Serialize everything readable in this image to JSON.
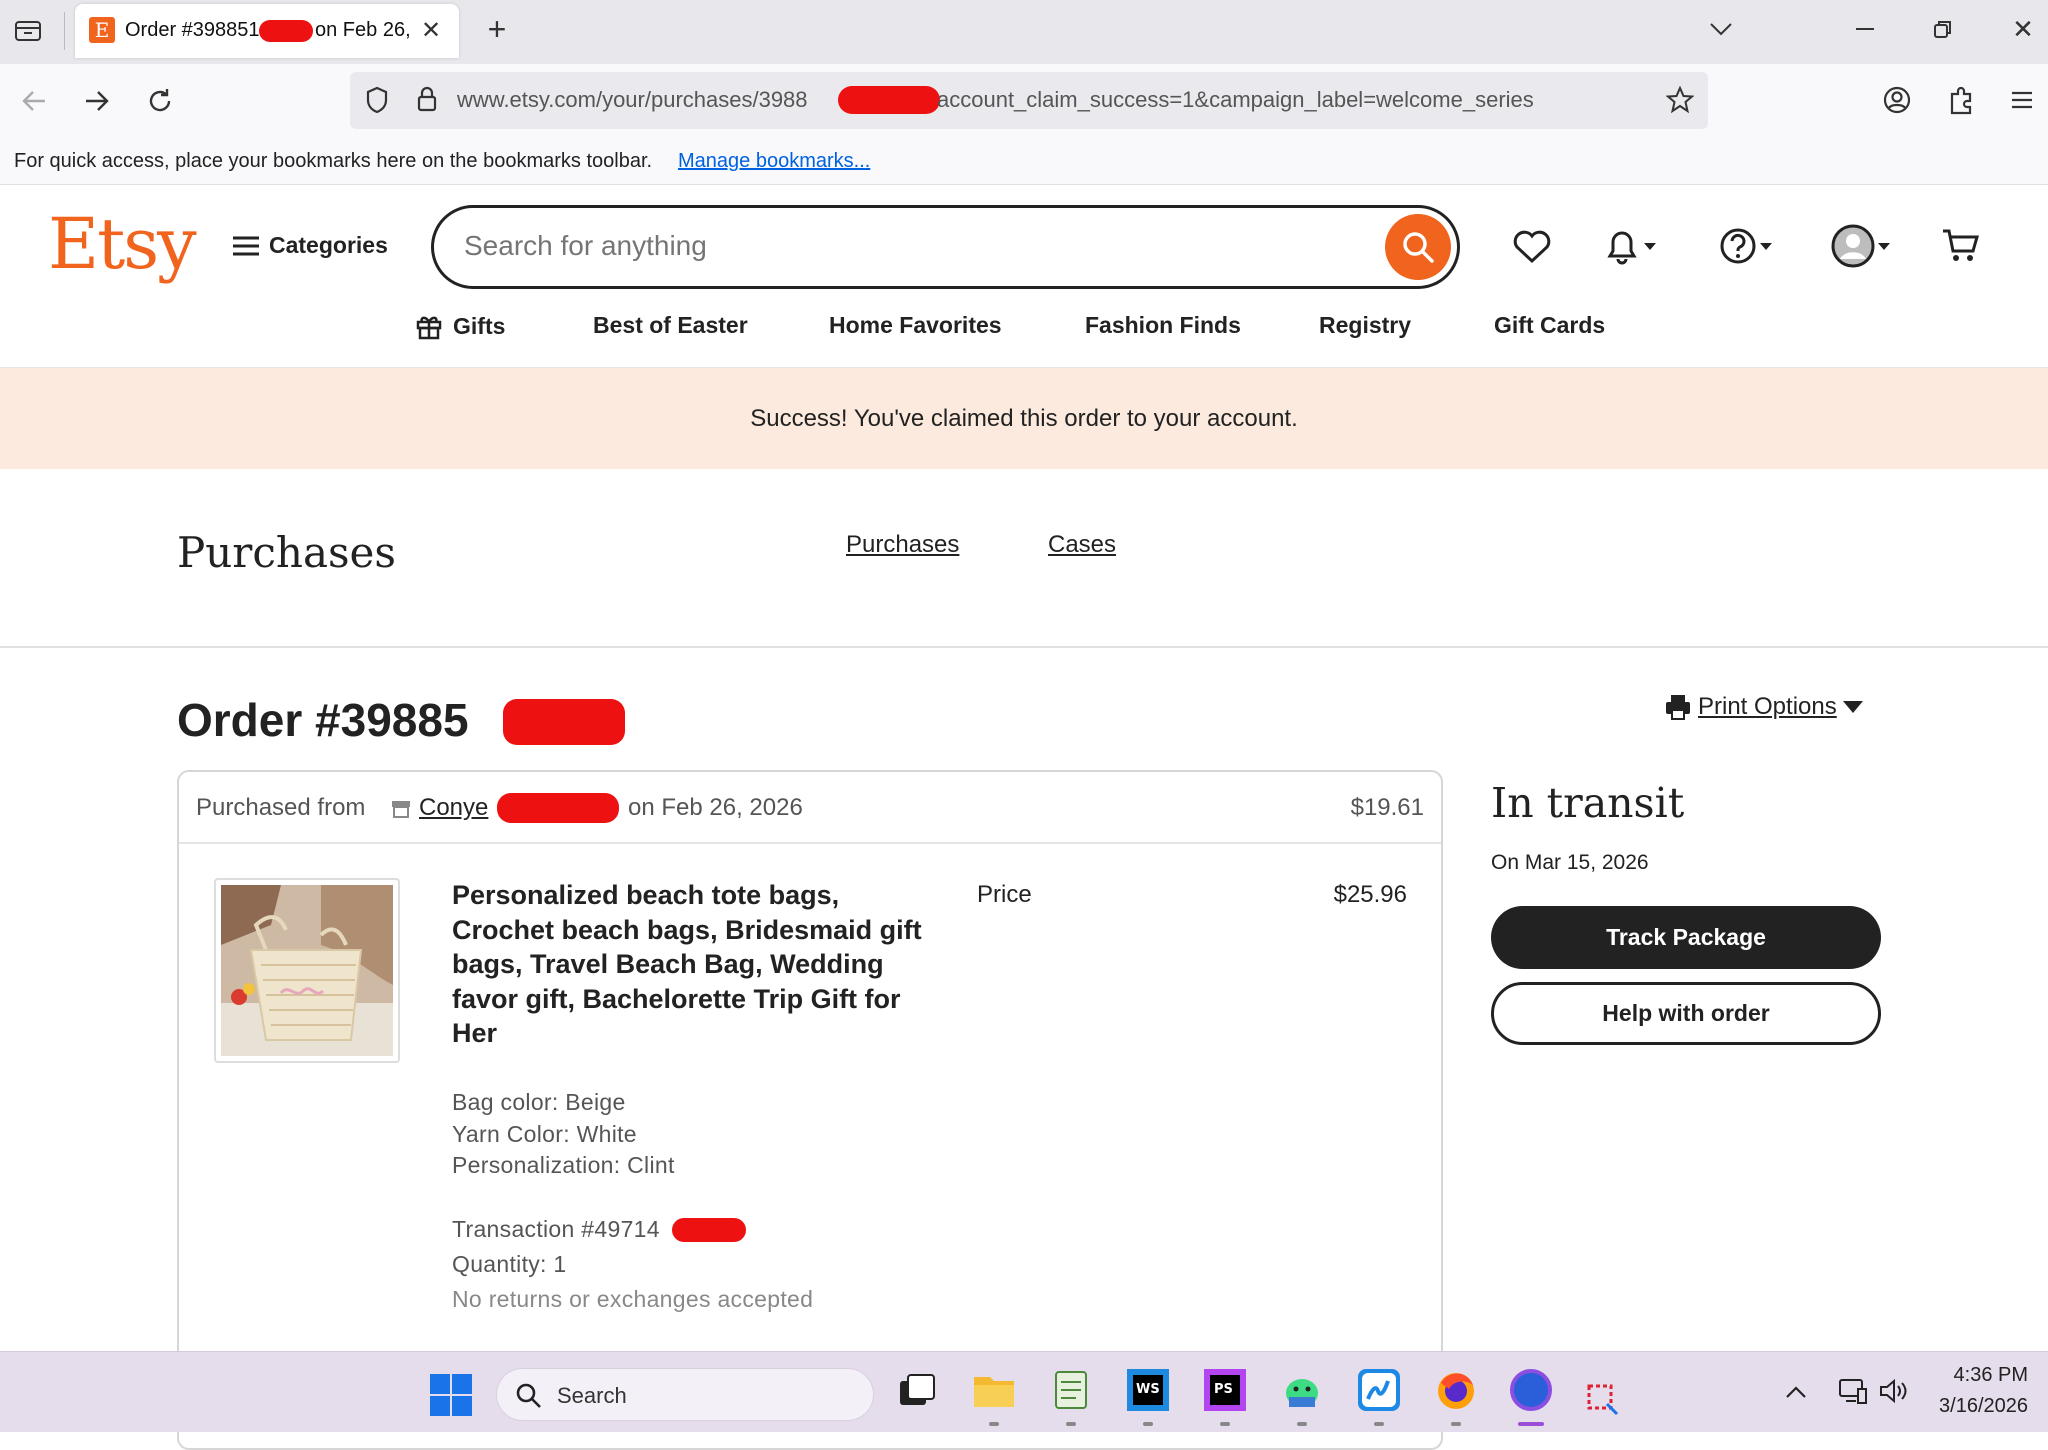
{
  "browser": {
    "tab_title_part1": "Order #398851",
    "tab_title_part2": "on Feb 26,",
    "tab_favicon_letter": "E",
    "url_part1": "www.etsy.com/your/purchases/3988",
    "url_part2": "account_claim_success=1&campaign_label=welcome_series",
    "bookmarks_text": "For quick access, place your bookmarks here on the bookmarks toolbar.",
    "bookmarks_link": "Manage bookmarks..."
  },
  "header": {
    "logo": "Etsy",
    "categories_label": "Categories",
    "search_placeholder": "Search for anything",
    "nav": [
      "Gifts",
      "Best of Easter",
      "Home Favorites",
      "Fashion Finds",
      "Registry",
      "Gift Cards"
    ]
  },
  "banner": {
    "text": "Success! You've claimed this order to your account."
  },
  "purchases": {
    "title": "Purchases",
    "tabs": [
      "Purchases",
      "Cases"
    ]
  },
  "order": {
    "title": "Order #39885",
    "print_options": "Print Options",
    "purchased_from_label": "Purchased from",
    "shop_name": "Conye",
    "purchase_date": "on Feb 26, 2026",
    "order_total": "$19.61",
    "item": {
      "title": "Personalized beach tote bags, Crochet beach bags, Bridesmaid gift bags, Travel Beach Bag, Wedding favor gift, Bachelorette Trip Gift for Her",
      "price_label": "Price",
      "price": "$25.96",
      "bag_color": "Bag color: Beige",
      "yarn_color": "Yarn Color: White",
      "personalization": "Personalization: Clint",
      "transaction": "Transaction #49714",
      "quantity": "Quantity: 1",
      "returns": "No returns or exchanges accepted"
    },
    "status": {
      "title": "In transit",
      "date": "On Mar 15, 2026",
      "track_button": "Track Package",
      "help_button": "Help with order"
    }
  },
  "taskbar": {
    "search_label": "Search",
    "time": "4:36 PM",
    "date": "3/16/2026"
  },
  "colors": {
    "etsy_orange": "#f1641e",
    "banner_bg": "#fbeadd",
    "redaction": "#ee1111"
  }
}
